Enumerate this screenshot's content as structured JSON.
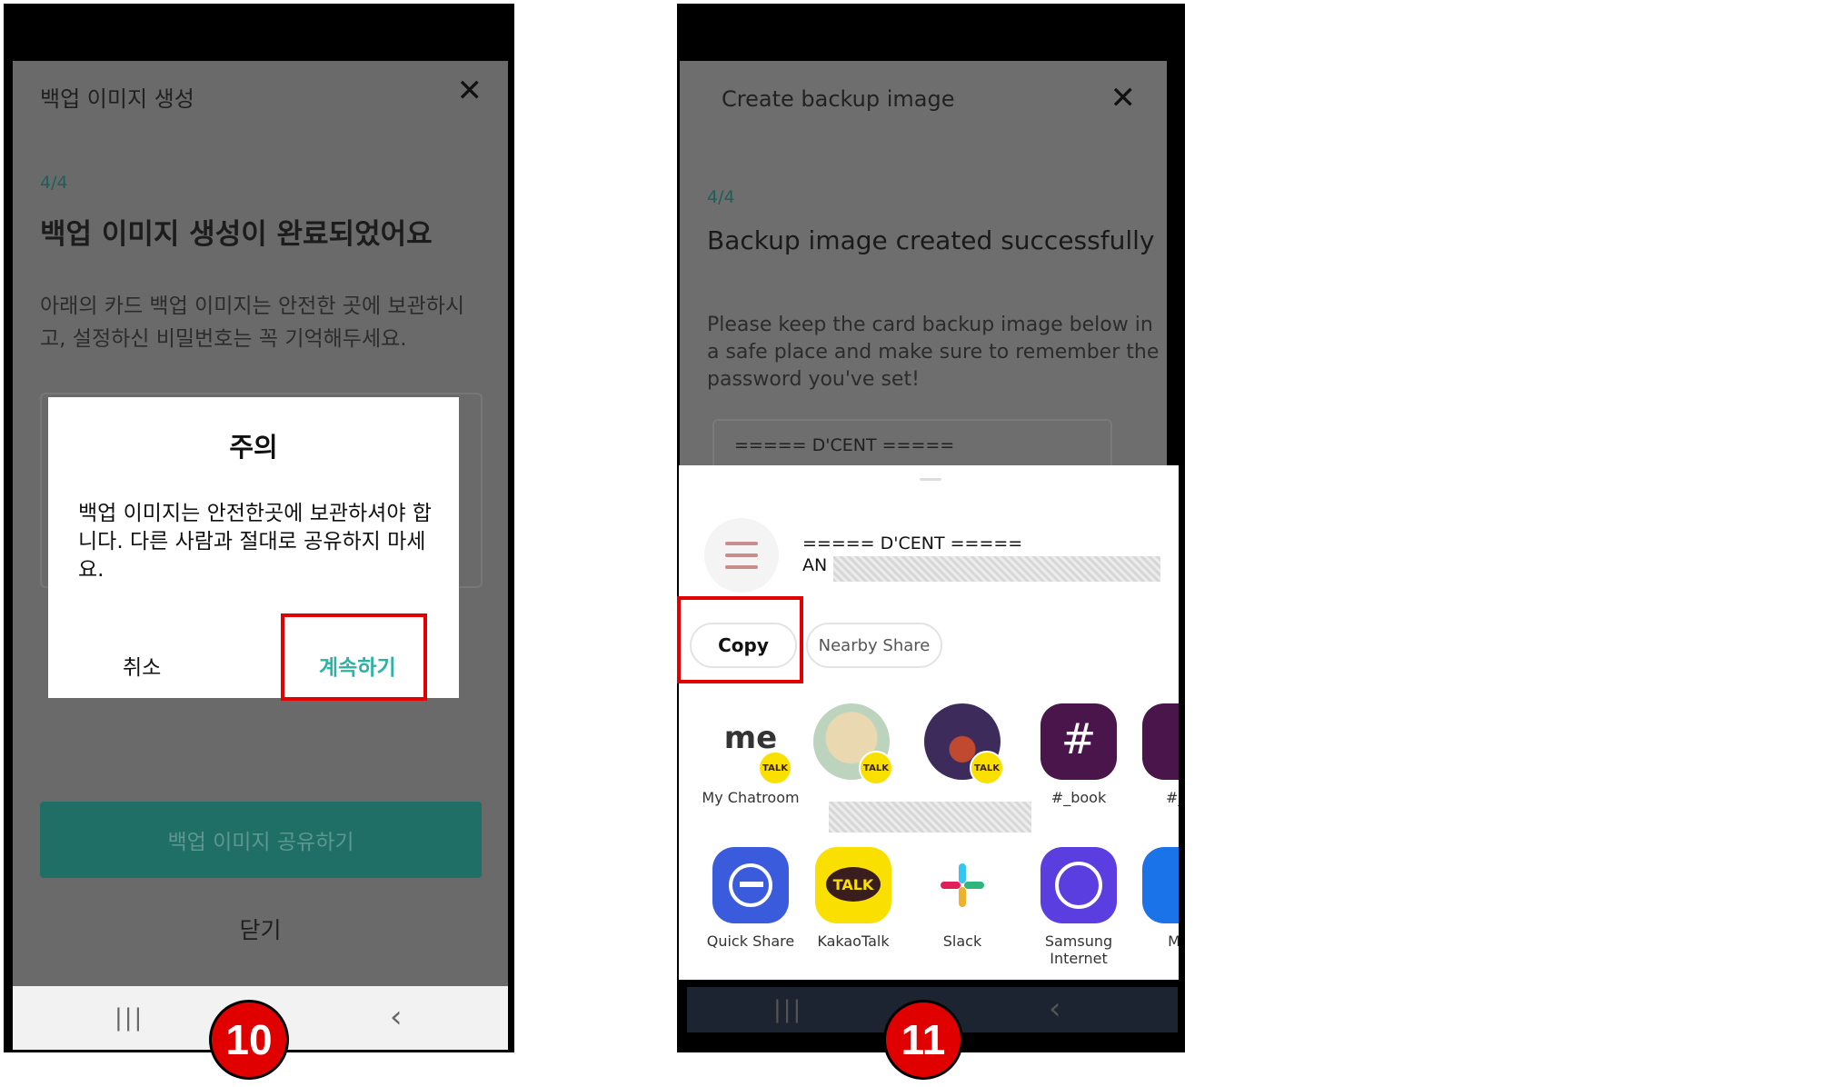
{
  "step_badges": {
    "left": "10",
    "right": "11"
  },
  "left_phone": {
    "header_title": "백업 이미지 생성",
    "close_glyph": "✕",
    "step": "4/4",
    "heading": "백업 이미지 생성이 완료되었어요",
    "description": "아래의 카드 백업 이미지는 안전한 곳에 보관하시고, 설정하신 비밀번호는 꼭 기억해두세요.",
    "dialog": {
      "title": "주의",
      "body": "백업 이미지는 안전한곳에 보관하셔야 합니다. 다른 사람과 절대로 공유하지 마세요.",
      "cancel_label": "취소",
      "continue_label": "계속하기"
    },
    "share_button_label": "백업 이미지 공유하기",
    "close_label": "닫기",
    "nav": {
      "menu_glyph": "|||",
      "back_glyph": "‹"
    }
  },
  "right_phone": {
    "header_title": "Create backup image",
    "close_glyph": "✕",
    "step": "4/4",
    "heading": "Backup image created successfully",
    "description": "Please keep the card backup image below in a safe place and make sure to remember the password you've set!",
    "backup_text": "===== D'CENT =====",
    "share_sheet": {
      "preview_line1": "===== D'CENT =====",
      "preview_line2": "AN",
      "copy_label": "Copy",
      "nearby_label": "Nearby Share",
      "contacts": [
        {
          "label": "My Chatroom",
          "icon": "me-icon"
        },
        {
          "label": "",
          "icon": "avatar-icon"
        },
        {
          "label": "",
          "icon": "avatar-icon"
        },
        {
          "label": "#_book",
          "icon": "slack-channel-icon"
        },
        {
          "label": "#_r",
          "icon": "slack-channel-icon"
        }
      ],
      "apps": [
        {
          "label": "Quick Share",
          "icon": "quick-share-icon"
        },
        {
          "label": "KakaoTalk",
          "icon": "kakaotalk-icon"
        },
        {
          "label": "Slack",
          "icon": "slack-icon"
        },
        {
          "label": "Samsung Internet",
          "icon": "samsung-internet-icon"
        },
        {
          "label": "Me",
          "icon": "messages-icon"
        }
      ],
      "me_text": "me",
      "talk_text": "TALK",
      "hash_glyph": "#"
    },
    "nav": {
      "menu_glyph": "|||",
      "back_glyph": "‹"
    }
  },
  "colors": {
    "accent_teal": "#2bb3a6",
    "highlight_red": "#e30000",
    "kakao_yellow": "#f9e000"
  }
}
